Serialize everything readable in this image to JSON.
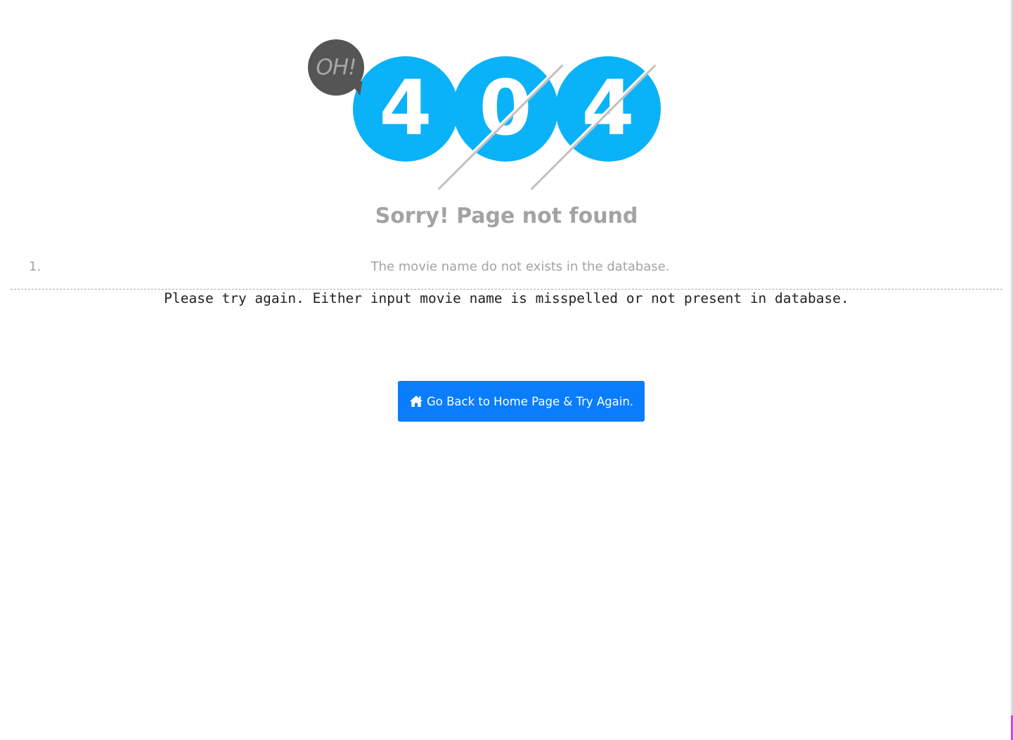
{
  "logo": {
    "bubble_text": "OH!",
    "digits": [
      "4",
      "0",
      "4"
    ]
  },
  "title": "Sorry! Page not found",
  "errors": [
    {
      "number": "1.",
      "text": "The movie name do not exists in the database."
    }
  ],
  "hint": "Please try again. Either input movie name is misspelled or not present in database.",
  "home_button": {
    "label": "Go Back to Home Page & Try Again.",
    "icon": "home-icon"
  },
  "colors": {
    "digit_circle": "#0ab2f8",
    "bubble": "#555555",
    "button": "#097dfc",
    "muted_text": "#a3a3a3"
  }
}
